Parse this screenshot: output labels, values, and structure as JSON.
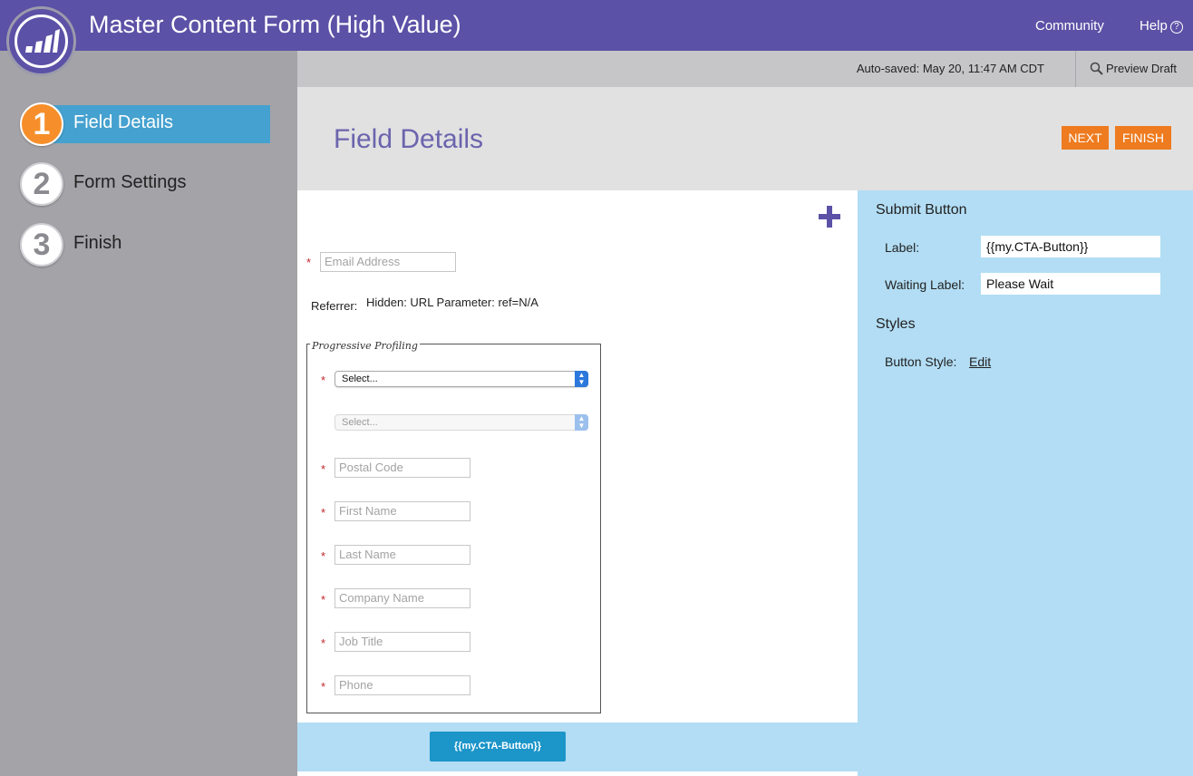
{
  "header": {
    "title": "Master Content Form (High Value)",
    "community": "Community",
    "help": "Help",
    "help_icon_glyph": "?",
    "brand_color": "#5b51a6"
  },
  "sidebar": {
    "steps": [
      {
        "number": "1",
        "label": "Field Details",
        "active": true
      },
      {
        "number": "2",
        "label": "Form Settings",
        "active": false
      },
      {
        "number": "3",
        "label": "Finish",
        "active": false
      }
    ]
  },
  "statusbar": {
    "autosaved": "Auto-saved: May 20, 11:47 AM CDT",
    "preview": "Preview Draft",
    "preview_icon": "search-icon"
  },
  "page": {
    "title": "Field Details",
    "next": "NEXT",
    "finish": "FINISH",
    "accent": "#ee7b1f"
  },
  "form": {
    "required_mark": "*",
    "email_placeholder": "Email Address",
    "referrer_label": "Referrer:",
    "referrer_value": "Hidden: URL Parameter: ref=N/A",
    "progressive_legend": "Progressive Profiling",
    "select_1": "Select...",
    "select_2": "Select...",
    "postal_code": "Postal Code",
    "first_name": "First Name",
    "last_name": "Last Name",
    "company_name": "Company Name",
    "job_title": "Job Title",
    "phone": "Phone",
    "submit_button": "{{my.CTA-Button}}"
  },
  "panel": {
    "submit_heading": "Submit Button",
    "label_label": "Label:",
    "label_value": "{{my.CTA-Button}}",
    "waiting_label": "Waiting Label:",
    "waiting_value": "Please Wait",
    "styles_heading": "Styles",
    "button_style_label": "Button Style:",
    "edit_link": "Edit"
  }
}
